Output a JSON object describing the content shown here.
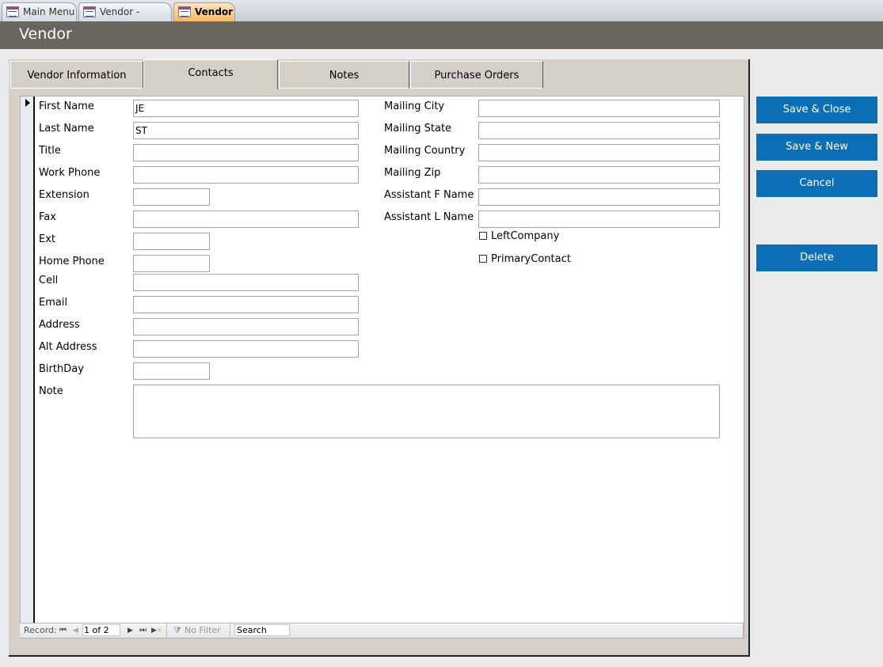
{
  "document_tabs": [
    {
      "label": "Main Menu",
      "icon": "form-icon",
      "active": false
    },
    {
      "label": "Vendor - Search",
      "icon": "form-icon",
      "active": false
    },
    {
      "label": "Vendor",
      "icon": "form-icon",
      "active": true
    }
  ],
  "header": {
    "title": "Vendor"
  },
  "form_tabs": [
    {
      "label": "Vendor Information",
      "active": false
    },
    {
      "label": "Contacts",
      "active": true
    },
    {
      "label": "Notes",
      "active": false
    },
    {
      "label": "Purchase Orders",
      "active": false
    }
  ],
  "contact_fields": {
    "first_name": {
      "label": "First Name",
      "value": "JE"
    },
    "last_name": {
      "label": "Last Name",
      "value": "ST"
    },
    "title": {
      "label": "Title",
      "value": ""
    },
    "work_phone": {
      "label": "Work Phone",
      "value": ""
    },
    "extension": {
      "label": "Extension",
      "value": ""
    },
    "fax": {
      "label": "Fax",
      "value": ""
    },
    "ext": {
      "label": "Ext",
      "value": ""
    },
    "home_phone": {
      "label": "Home Phone",
      "value": ""
    },
    "cell": {
      "label": "Cell",
      "value": ""
    },
    "email": {
      "label": "Email",
      "value": ""
    },
    "address": {
      "label": "Address",
      "value": ""
    },
    "alt_address": {
      "label": "Alt Address",
      "value": ""
    },
    "birthday": {
      "label": "BirthDay",
      "value": ""
    },
    "note": {
      "label": "Note",
      "value": ""
    },
    "mailing_city": {
      "label": "Mailing City",
      "value": ""
    },
    "mailing_state": {
      "label": "Mailing State",
      "value": ""
    },
    "mailing_country": {
      "label": "Mailing Country",
      "value": ""
    },
    "mailing_zip": {
      "label": "Mailing Zip",
      "value": ""
    },
    "assistant_f_name": {
      "label": "Assistant F Name",
      "value": ""
    },
    "assistant_l_name": {
      "label": "Assistant L Name",
      "value": ""
    }
  },
  "checkboxes": {
    "left_company": {
      "label": "LeftCompany",
      "checked": false
    },
    "primary_contact": {
      "label": "PrimaryContact",
      "checked": false
    }
  },
  "record_nav": {
    "label": "Record:",
    "current": "1 of 2",
    "filter_label": "No Filter",
    "search_placeholder": "Search"
  },
  "actions": {
    "save_close": "Save & Close",
    "save_new": "Save & New",
    "cancel": "Cancel",
    "delete": "Delete"
  },
  "colors": {
    "accent_button": "#0b6fb8",
    "header_bar": "#696660",
    "active_doc_tab": "#f8b866"
  }
}
